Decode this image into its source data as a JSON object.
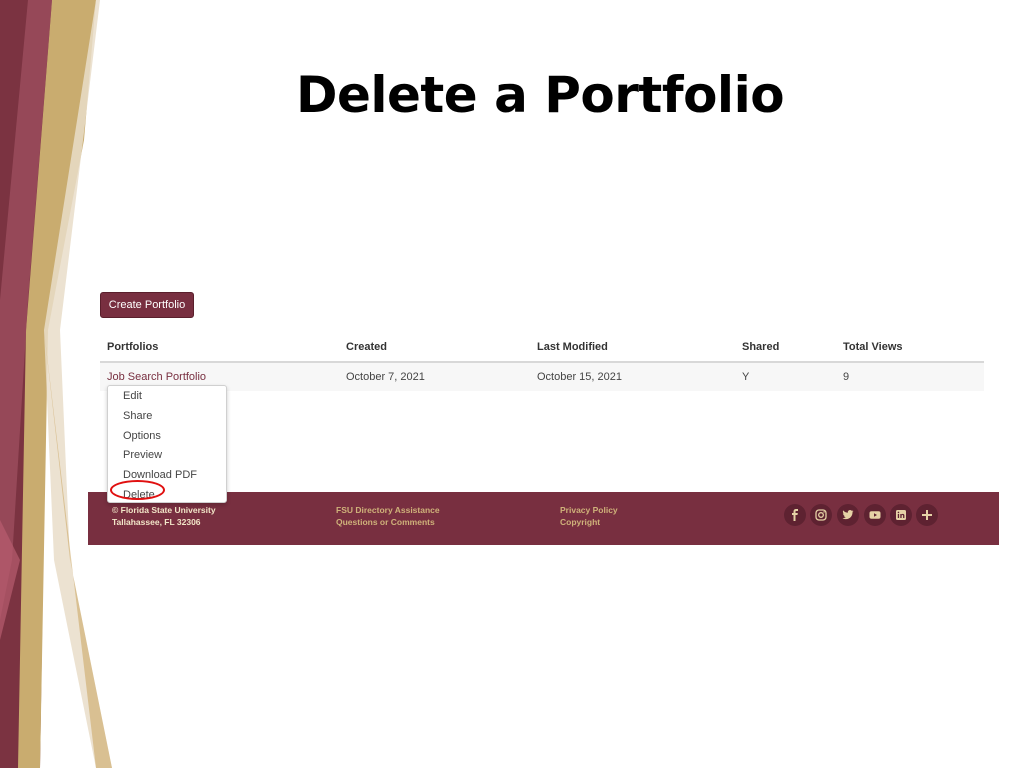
{
  "slide": {
    "title": "Delete a Portfolio"
  },
  "toolbar": {
    "create_label": "Create Portfolio"
  },
  "table": {
    "headers": [
      "Portfolios",
      "Created",
      "Last Modified",
      "Shared",
      "Total Views"
    ],
    "rows": [
      {
        "name": "Job Search Portfolio",
        "created": "October 7, 2021",
        "modified": "October 15, 2021",
        "shared": "Y",
        "views": "9"
      }
    ]
  },
  "menu": {
    "items": [
      "Edit",
      "Share",
      "Options",
      "Preview",
      "Download PDF",
      "Delete"
    ]
  },
  "footer": {
    "copyright": "© Florida State University",
    "address": "Tallahassee, FL 32306",
    "directory": "FSU Directory Assistance",
    "questions": "Questions or Comments",
    "privacy": "Privacy Policy",
    "copyright_link": "Copyright"
  },
  "social": [
    "facebook-icon",
    "instagram-icon",
    "twitter-icon",
    "youtube-icon",
    "linkedin-icon",
    "plus-icon"
  ],
  "colors": {
    "garnet": "#782f40",
    "gold": "#cfb27a",
    "highlight": "#e01010"
  }
}
